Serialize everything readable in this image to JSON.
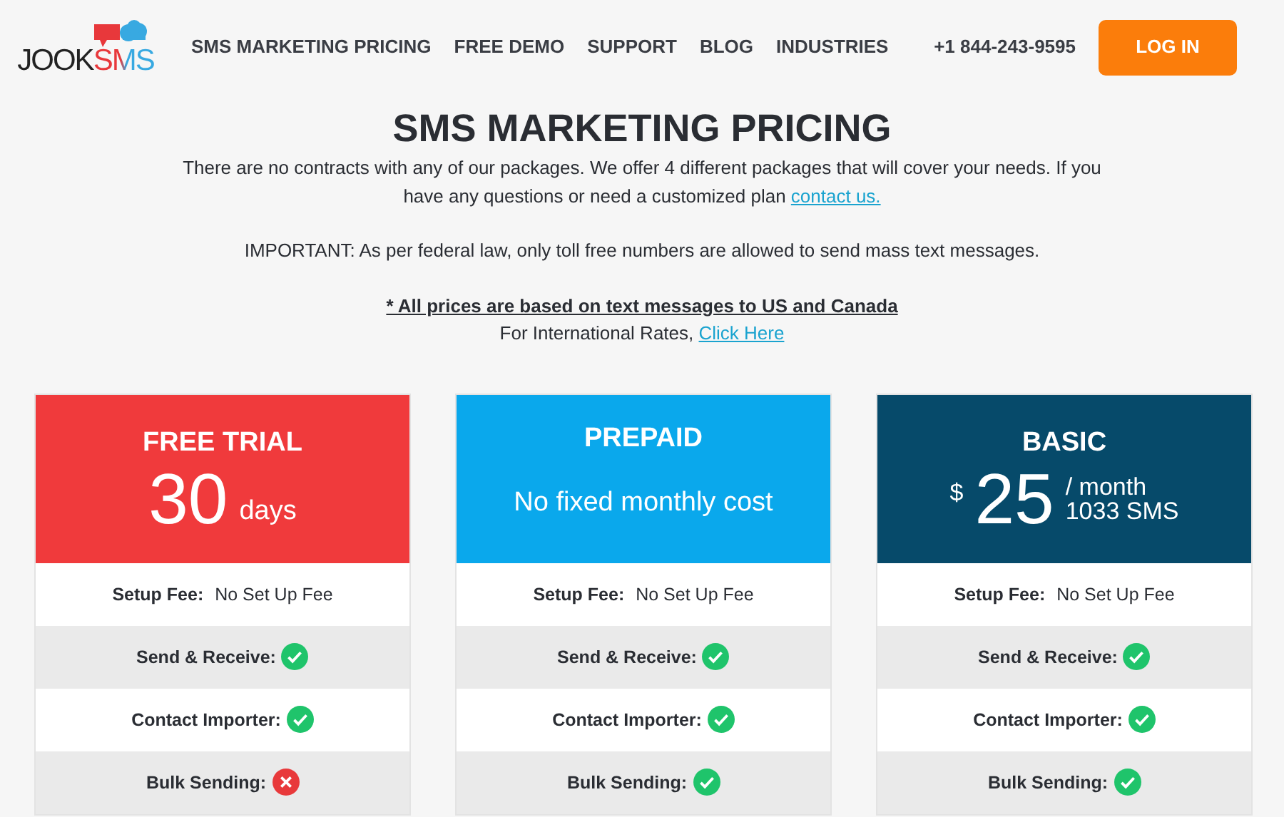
{
  "logo": {
    "first": "JOOK",
    "second": "SMS"
  },
  "nav": [
    {
      "label": "SMS MARKETING PRICING"
    },
    {
      "label": "FREE DEMO"
    },
    {
      "label": "SUPPORT"
    },
    {
      "label": "BLOG"
    },
    {
      "label": "INDUSTRIES"
    }
  ],
  "phone": "+1 844-243-9595",
  "login": "LOG IN",
  "title": "SMS MARKETING PRICING",
  "intro": {
    "text": "There are no contracts with any of our packages. We offer 4 different packages that will cover your needs.  If you have any questions or need a customized plan",
    "link": "contact us."
  },
  "important": "IMPORTANT: As per federal law, only toll free numbers are allowed to send mass text messages.",
  "note": "* All prices are based on text messages to US and Canada",
  "international": {
    "text": "For International Rates,",
    "link": "Click Here"
  },
  "plans": [
    {
      "name": "FREE TRIAL",
      "color": "#f03a3c",
      "kind": "trial",
      "amount": "30",
      "unit": "days",
      "features": [
        {
          "kind": "text",
          "label": "Setup Fee:",
          "value": "No Set Up Fee"
        },
        {
          "kind": "check",
          "label": "Send & Receive:",
          "included": true
        },
        {
          "kind": "check",
          "label": "Contact Importer:",
          "included": true
        },
        {
          "kind": "check",
          "label": "Bulk Sending:",
          "included": false
        }
      ]
    },
    {
      "name": "PREPAID",
      "color": "#0aa8ec",
      "kind": "text",
      "subtitle": "No fixed monthly cost",
      "features": [
        {
          "kind": "text",
          "label": "Setup Fee:",
          "value": "No Set Up Fee"
        },
        {
          "kind": "check",
          "label": "Send & Receive:",
          "included": true
        },
        {
          "kind": "check",
          "label": "Contact Importer:",
          "included": true
        },
        {
          "kind": "check",
          "label": "Bulk Sending:",
          "included": true
        }
      ]
    },
    {
      "name": "BASIC",
      "color": "#064a6a",
      "kind": "price",
      "currency": "$",
      "amount": "25",
      "period": "/ month",
      "quota": "1033 SMS",
      "features": [
        {
          "kind": "text",
          "label": "Setup Fee:",
          "value": "No Set Up Fee"
        },
        {
          "kind": "check",
          "label": "Send & Receive:",
          "included": true
        },
        {
          "kind": "check",
          "label": "Contact Importer:",
          "included": true
        },
        {
          "kind": "check",
          "label": "Bulk Sending:",
          "included": true
        }
      ]
    }
  ]
}
